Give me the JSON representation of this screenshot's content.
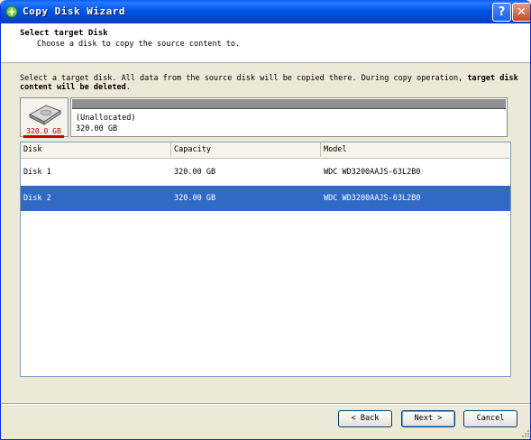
{
  "window": {
    "title": "Copy Disk Wizard",
    "help_label": "?",
    "close_label": "✕",
    "icon": "wizard-app-icon"
  },
  "header": {
    "title": "Select target Disk",
    "subtitle": "Choose a disk to copy the source content to."
  },
  "description": {
    "text": "Select a target disk. All data from the source disk will be copied there. During copy operation,",
    "bold": "target disk content will be deleted",
    "end": "."
  },
  "disk_map": {
    "disk_size": "320.0 GB",
    "partition_name": "(Unallocated)",
    "partition_size": "320.00 GB",
    "icon": "hard-disk-icon"
  },
  "table": {
    "columns": [
      "Disk",
      "Capacity",
      "Model"
    ],
    "rows": [
      {
        "disk": "Disk 1",
        "capacity": "320.00 GB",
        "model": "WDC WD3200AAJS-63L2B0",
        "selected": false
      },
      {
        "disk": "Disk 2",
        "capacity": "320.00 GB",
        "model": "WDC WD3200AAJS-63L2B0",
        "selected": true
      }
    ]
  },
  "buttons": {
    "back": "< Back",
    "next": "Next >",
    "cancel": "Cancel"
  },
  "colors": {
    "titlebar": "#0055e5",
    "selection": "#316ac5",
    "disk_marker": "#d00000"
  }
}
